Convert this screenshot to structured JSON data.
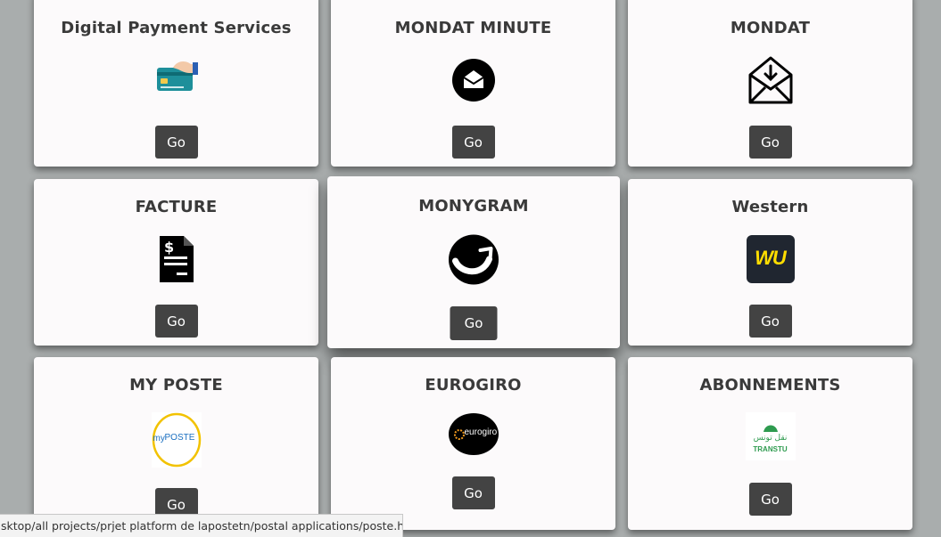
{
  "cards": [
    {
      "title": "Digital Payment Services",
      "icon": "card-payment-icon",
      "button": "Go"
    },
    {
      "title": "MONDAT MINUTE",
      "icon": "envelope-circle-icon",
      "button": "Go"
    },
    {
      "title": "MONDAT",
      "icon": "mail-download-icon",
      "button": "Go"
    },
    {
      "title": "FACTURE",
      "icon": "invoice-icon",
      "button": "Go"
    },
    {
      "title": "MONYGRAM",
      "icon": "moneygram-logo-icon",
      "button": "Go"
    },
    {
      "title": "Western",
      "icon": "western-union-logo-icon",
      "button": "Go"
    },
    {
      "title": "MY POSTE",
      "icon": "my-poste-logo-icon",
      "button": "Go"
    },
    {
      "title": "EUROGIRO",
      "icon": "eurogiro-logo-icon",
      "button": "Go"
    },
    {
      "title": "ABONNEMENTS",
      "icon": "transtu-logo-icon",
      "button": "Go"
    }
  ],
  "logos": {
    "wu": "WU",
    "myposte_my": "my",
    "myposte_poste": "POSTE",
    "eurogiro": "eurogiro",
    "transtu_ar": "نقل تونس",
    "transtu_latin": "TRANSTU"
  },
  "status_bar": {
    "url": "sktop/all projects/prjet platform de lapostetn/postal applications/poste.html#"
  },
  "colors": {
    "background": "#a9adad",
    "card": "#fcfafb",
    "button": "#434343",
    "wu_yellow": "#ffdd00",
    "eurogiro_orange": "#f29a1e",
    "myposte_yellow": "#f2c200"
  }
}
